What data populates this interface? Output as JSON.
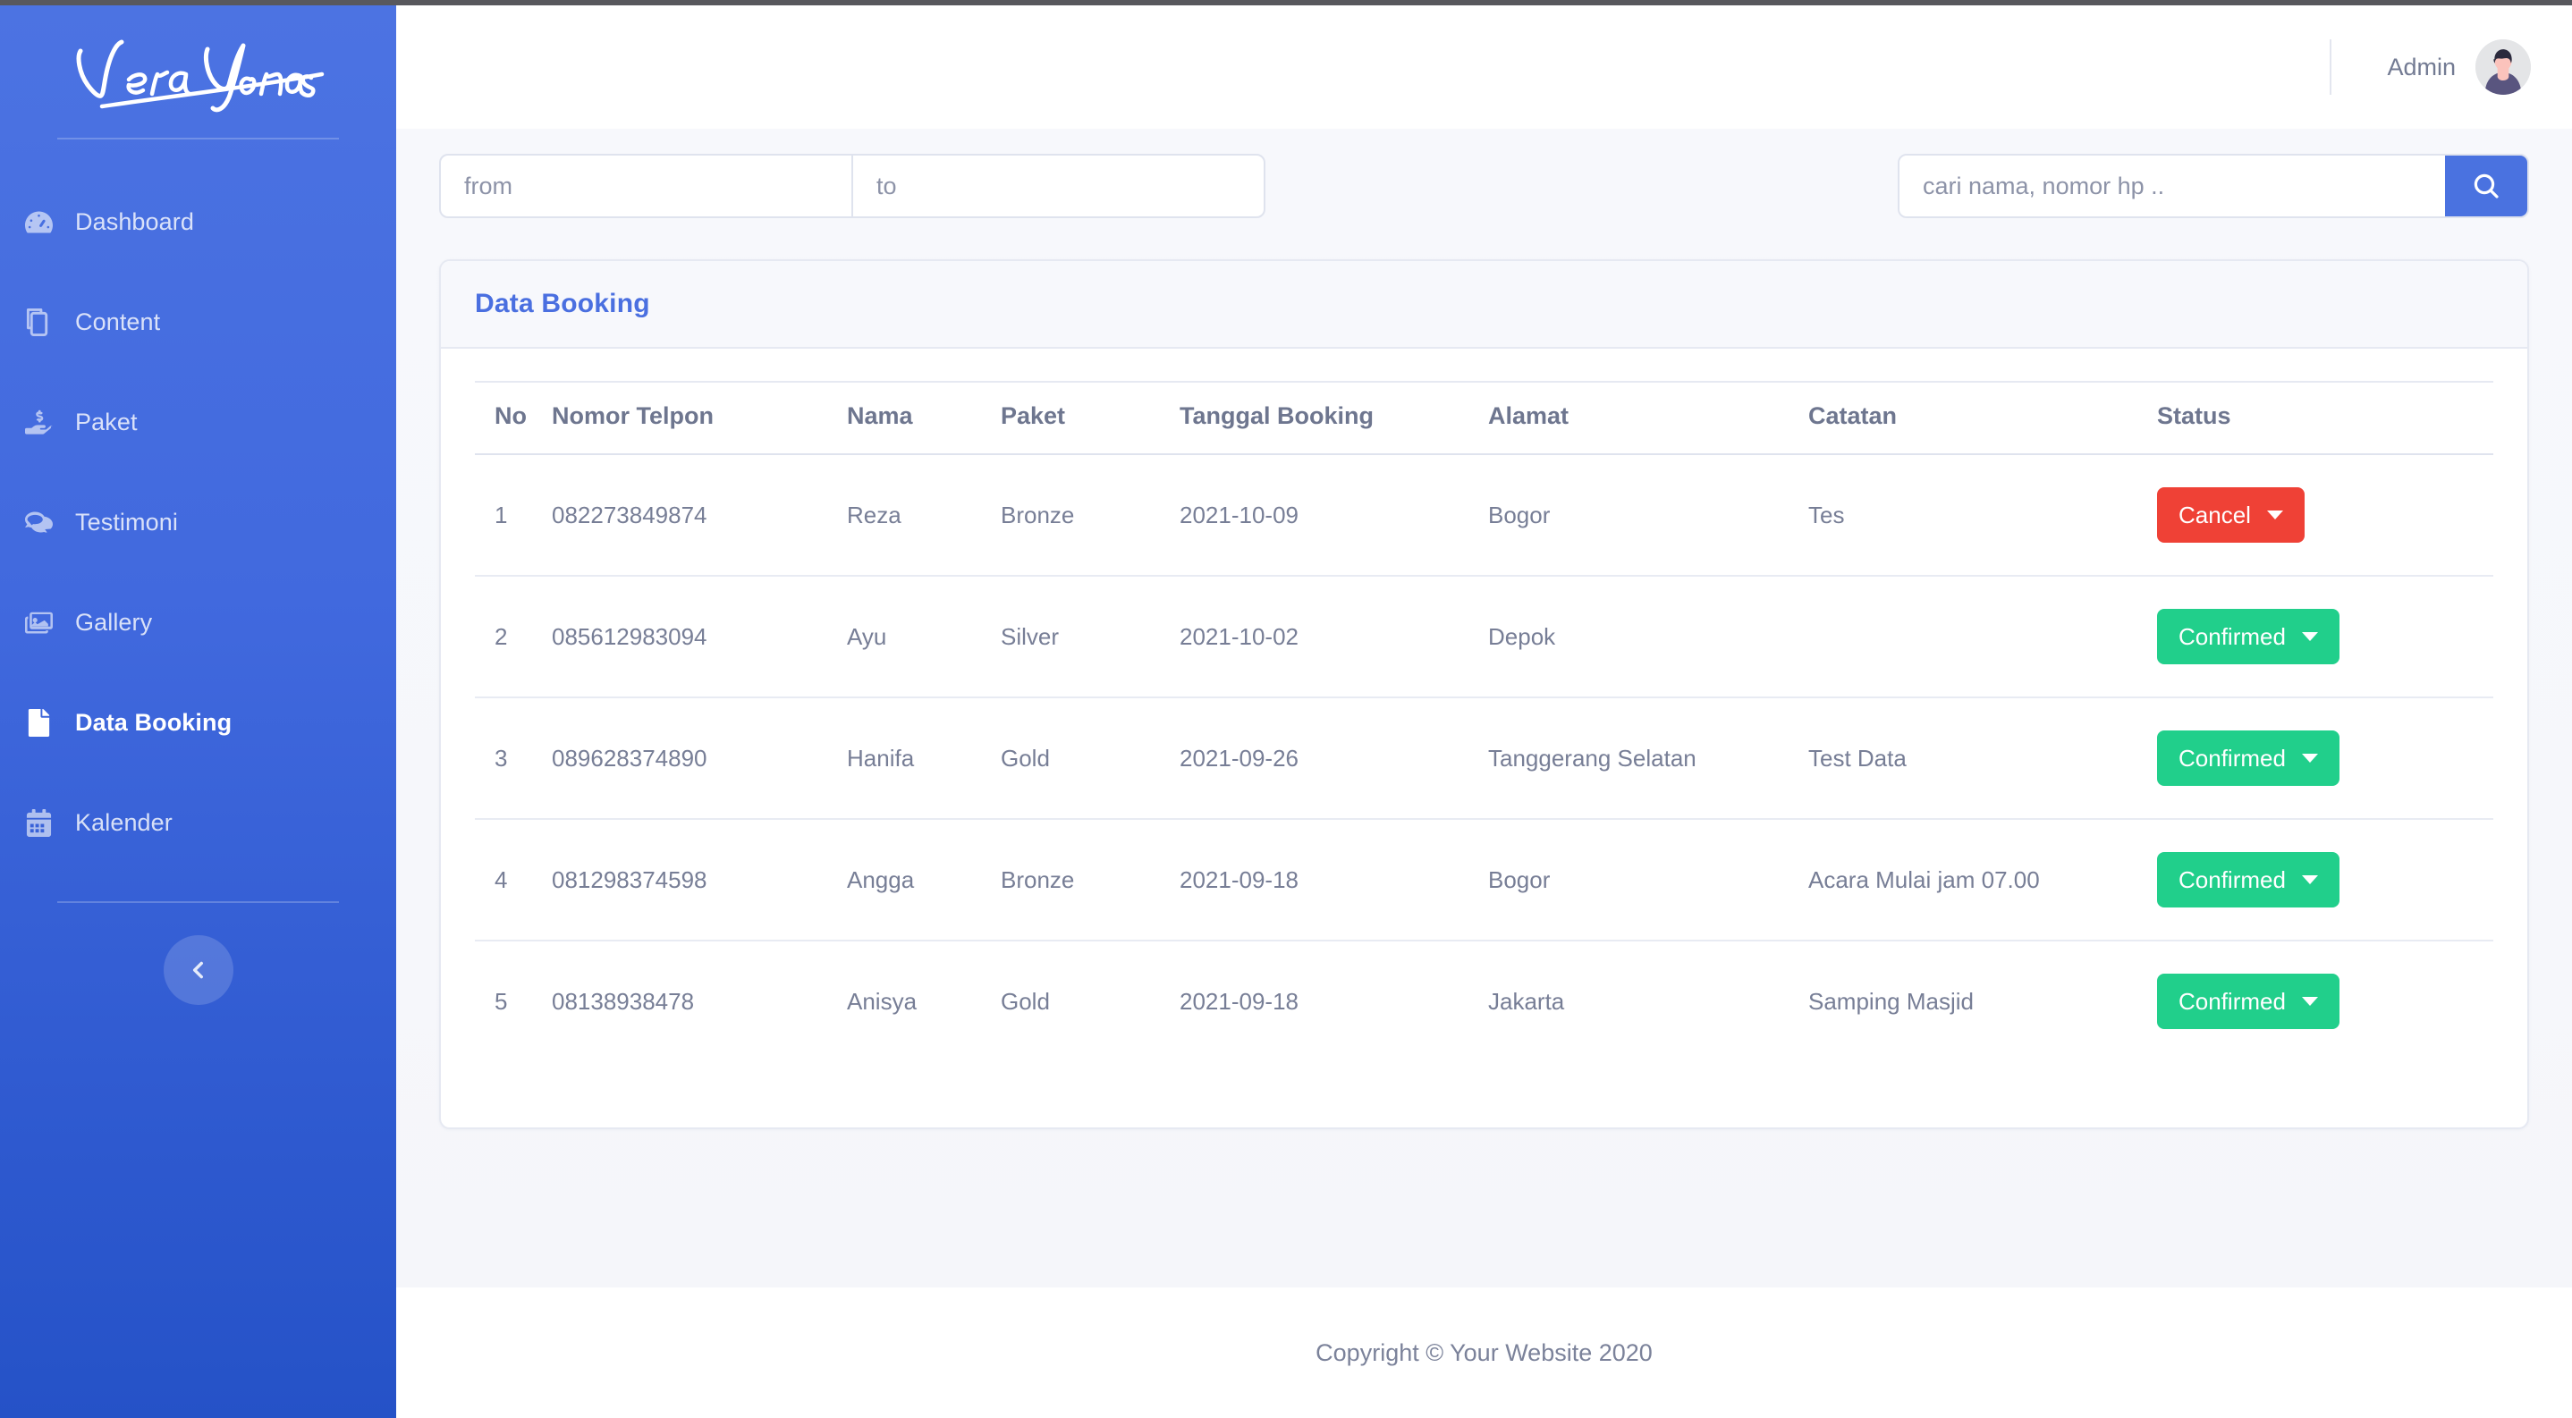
{
  "brand": {
    "logo_text": "Vera Yonas",
    "logo_icon": "script-wordmark-logo"
  },
  "sidebar": {
    "items": [
      {
        "label": "Dashboard",
        "icon": "tachometer-icon",
        "active": false
      },
      {
        "label": "Content",
        "icon": "layers-copy-icon",
        "active": false
      },
      {
        "label": "Paket",
        "icon": "hand-holding-usd-icon",
        "active": false
      },
      {
        "label": "Testimoni",
        "icon": "comments-icon",
        "active": false
      },
      {
        "label": "Gallery",
        "icon": "images-icon",
        "active": false
      },
      {
        "label": "Data Booking",
        "icon": "file-icon",
        "active": true
      },
      {
        "label": "Kalender",
        "icon": "calendar-icon",
        "active": false
      }
    ],
    "collapse_icon": "chevron-left-icon"
  },
  "topbar": {
    "user_name": "Admin",
    "avatar_icon": "user-avatar"
  },
  "filters": {
    "date_from": {
      "value": "",
      "placeholder": "from"
    },
    "date_to": {
      "value": "",
      "placeholder": "to"
    },
    "search": {
      "value": "",
      "placeholder": "cari nama, nomor hp .."
    },
    "search_icon": "search-icon"
  },
  "card": {
    "title": "Data Booking"
  },
  "table": {
    "columns": [
      "No",
      "Nomor Telpon",
      "Nama",
      "Paket",
      "Tanggal Booking",
      "Alamat",
      "Catatan",
      "Status"
    ],
    "rows": [
      {
        "no": "1",
        "nomor_telpon": "082273849874",
        "nama": "Reza",
        "paket": "Bronze",
        "tanggal_booking": "2021-10-09",
        "alamat": "Bogor",
        "catatan": "Tes",
        "status": "Cancel",
        "status_kind": "cancel"
      },
      {
        "no": "2",
        "nomor_telpon": "085612983094",
        "nama": "Ayu",
        "paket": "Silver",
        "tanggal_booking": "2021-10-02",
        "alamat": "Depok",
        "catatan": "",
        "status": "Confirmed",
        "status_kind": "confirmed"
      },
      {
        "no": "3",
        "nomor_telpon": "089628374890",
        "nama": "Hanifa",
        "paket": "Gold",
        "tanggal_booking": "2021-09-26",
        "alamat": "Tanggerang Selatan",
        "catatan": "Test Data",
        "status": "Confirmed",
        "status_kind": "confirmed"
      },
      {
        "no": "4",
        "nomor_telpon": "081298374598",
        "nama": "Angga",
        "paket": "Bronze",
        "tanggal_booking": "2021-09-18",
        "alamat": "Bogor",
        "catatan": "Acara Mulai jam 07.00",
        "status": "Confirmed",
        "status_kind": "confirmed"
      },
      {
        "no": "5",
        "nomor_telpon": "08138938478",
        "nama": "Anisya",
        "paket": "Gold",
        "tanggal_booking": "2021-09-18",
        "alamat": "Jakarta",
        "catatan": "Samping Masjid",
        "status": "Confirmed",
        "status_kind": "confirmed"
      }
    ]
  },
  "footer": {
    "copyright": "Copyright © Your Website 2020"
  },
  "colors": {
    "sidebar_top": "#4c73e2",
    "sidebar_bottom": "#2552c7",
    "accent_blue": "#4a72e0",
    "title_blue": "#4a6fe0",
    "status_confirmed": "#21cf8b",
    "status_cancel": "#ef4136",
    "page_bg": "#f7f8fc",
    "text_muted": "#777e96"
  }
}
